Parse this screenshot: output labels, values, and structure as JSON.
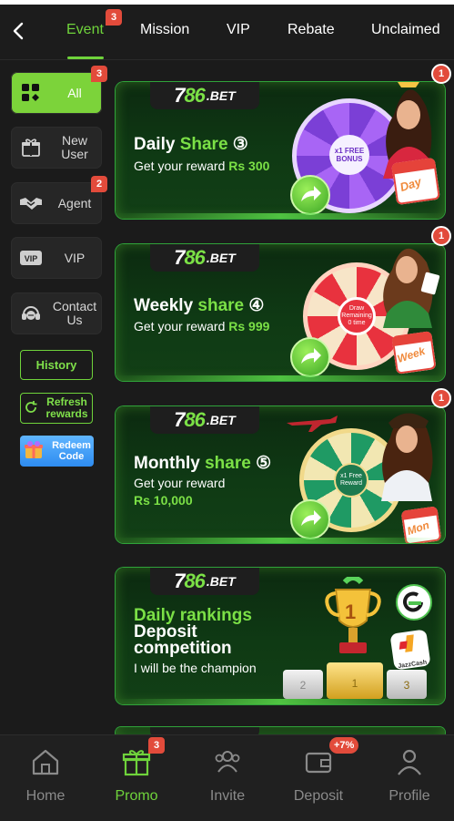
{
  "tabs": [
    {
      "label": "Event",
      "badge": "3",
      "active": true
    },
    {
      "label": "Mission"
    },
    {
      "label": "VIP"
    },
    {
      "label": "Rebate"
    },
    {
      "label": "Unclaimed"
    }
  ],
  "sidebar": {
    "items": [
      {
        "label": "All",
        "badge": "3",
        "active": true,
        "icon": "grid-icon"
      },
      {
        "label": "New User",
        "icon": "gift-icon"
      },
      {
        "label": "Agent",
        "badge": "2",
        "icon": "handshake-icon"
      },
      {
        "label": "VIP",
        "icon": "vip-card-icon"
      },
      {
        "label": "Contact Us",
        "icon": "headset-icon"
      }
    ],
    "history_label": "History",
    "refresh_label": "Refresh rewards",
    "redeem_label": "Redeem Code"
  },
  "banners": [
    {
      "logo_num_white": "7",
      "logo_num_green": "86",
      "logo_suffix": ".BET",
      "title_white": "Daily ",
      "title_green": "Share",
      "title_num": "③",
      "sub": "Get your reward ",
      "amount": "Rs 300",
      "badge": "1",
      "tag": "Day",
      "wheel_center": "x1 FREE BONUS"
    },
    {
      "logo_num_white": "7",
      "logo_num_green": "86",
      "logo_suffix": ".BET",
      "title_white": "Weekly ",
      "title_green": "share",
      "title_num": "④",
      "sub": "Get your reward ",
      "amount": "Rs 999",
      "badge": "1",
      "tag": "Week",
      "wheel_center": "Draw Remaining 0 time"
    },
    {
      "logo_num_white": "7",
      "logo_num_green": "86",
      "logo_suffix": ".BET",
      "title_white": "Monthly ",
      "title_green": "share",
      "title_num": "⑤",
      "sub": "Get your reward",
      "amount": "Rs 10,000",
      "badge": "1",
      "tag": "Mon",
      "wheel_center": "x1 Free Reward"
    },
    {
      "logo_num_white": "7",
      "logo_num_green": "86",
      "logo_suffix": ".BET",
      "line1": "Daily rankings",
      "line2": "Deposit",
      "line3": "competition",
      "line4": "I will be the champion",
      "trophy_rank": "1",
      "podium_left": "2",
      "podium_right": "3",
      "wallet_label": "JazzCash"
    }
  ],
  "bottom_nav": [
    {
      "label": "Home",
      "icon": "home-icon"
    },
    {
      "label": "Promo",
      "icon": "gift-icon",
      "active": true,
      "badge": "3"
    },
    {
      "label": "Invite",
      "icon": "users-icon"
    },
    {
      "label": "Deposit",
      "icon": "wallet-icon",
      "badge": "+7%"
    },
    {
      "label": "Profile",
      "icon": "user-icon"
    }
  ],
  "colors": {
    "accent": "#6fd33b",
    "badge": "#e24b3b",
    "background": "#1b1b1b"
  }
}
